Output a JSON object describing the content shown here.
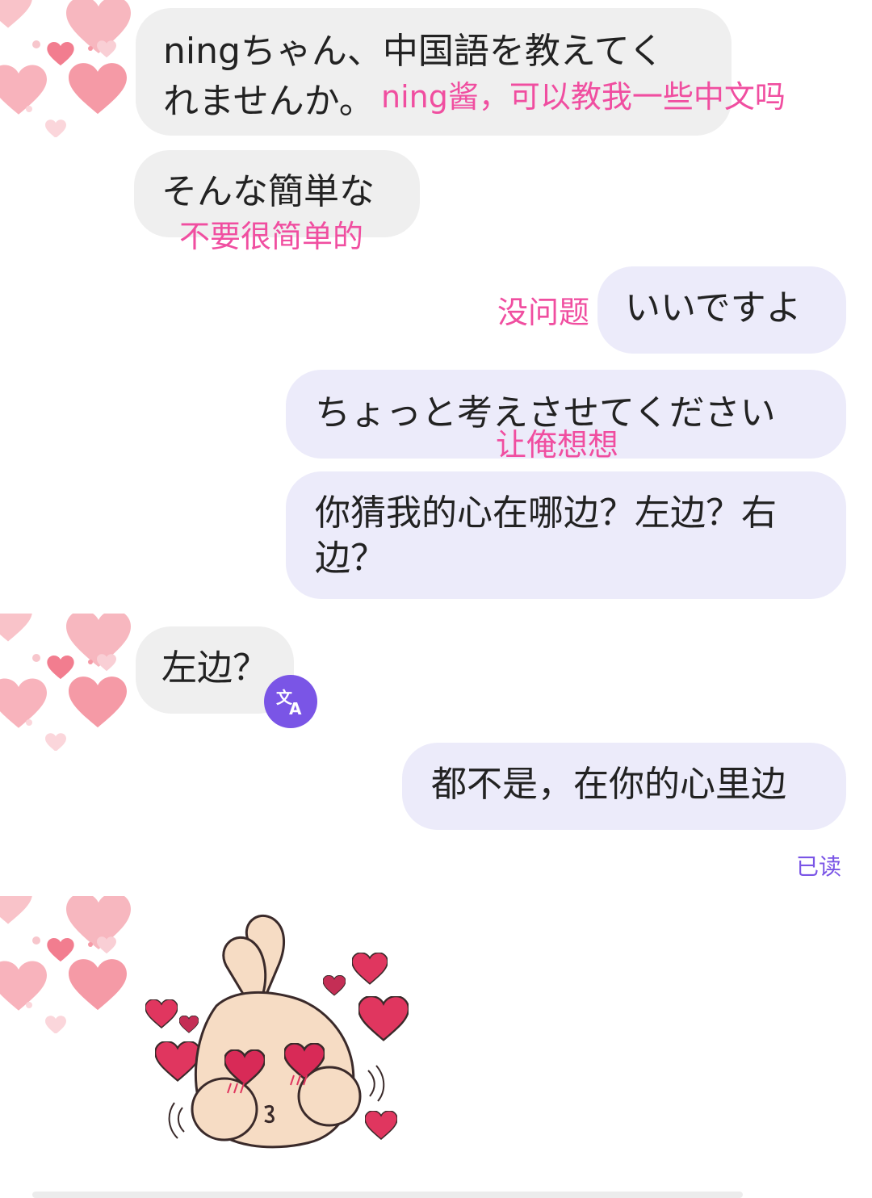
{
  "messages": {
    "m1": {
      "line1": "ningちゃん、中国語を教えてく",
      "line2": "れませんか。",
      "annotation": "ning酱，可以教我一些中文吗"
    },
    "m2": {
      "text": "そんな簡単な",
      "annotation": "不要很简单的"
    },
    "m3": {
      "text": "いいですよ",
      "annotation": "没问题"
    },
    "m4": {
      "text": "ちょっと考えさせてください",
      "annotation": "让俺想想"
    },
    "m5": {
      "line1": "你猜我的心在哪边？左边？右",
      "line2": "边？"
    },
    "m6": {
      "text": "左边？"
    },
    "m7": {
      "text": "都不是，在你的心里边"
    }
  },
  "status": {
    "read_label": "已读"
  },
  "icons": {
    "avatar": "hearts-avatar-icon",
    "translate": "translate-icon",
    "sticker": "finger-heart-sticker-icon"
  },
  "colors": {
    "incoming_bubble": "#efefef",
    "outgoing_bubble": "#ecebfa",
    "annotation": "#f04ea0",
    "accent": "#7a55e6"
  }
}
